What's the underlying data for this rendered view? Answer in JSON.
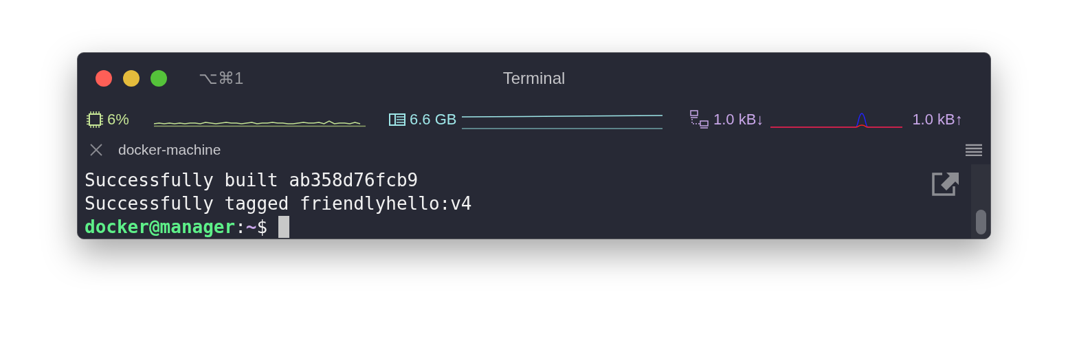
{
  "window": {
    "title": "Terminal",
    "shortcut": "⌥⌘1"
  },
  "status_bar": {
    "cpu": "6%",
    "memory": "6.6 GB",
    "network_down": "1.0 kB↓",
    "network_up": "1.0 kB↑"
  },
  "tab": {
    "label": "docker-machine"
  },
  "terminal": {
    "lines": [
      {
        "kind": "output",
        "text": "Successfully built ab358d76fcb9"
      },
      {
        "kind": "output",
        "text": "Successfully tagged friendlyhello:v4"
      },
      {
        "kind": "prompt",
        "user": "docker@manager",
        "separator": ":",
        "path": "~",
        "symbol": "$",
        "cursor": true
      }
    ]
  }
}
